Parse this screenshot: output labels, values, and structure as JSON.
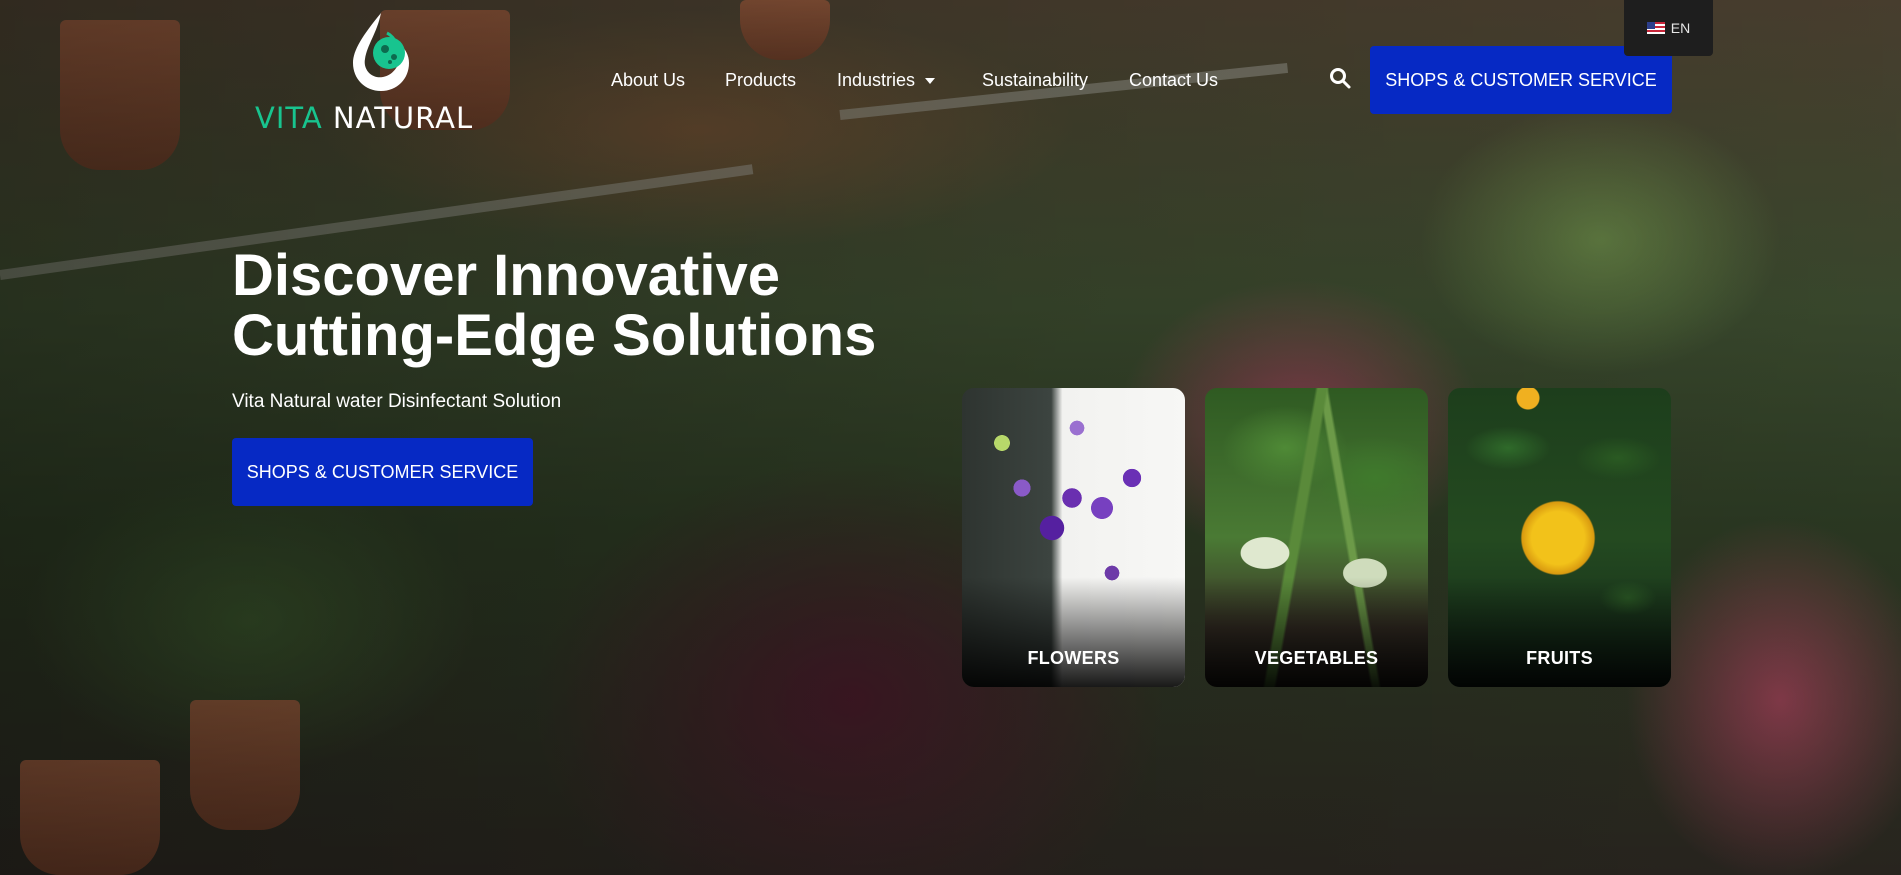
{
  "brand": {
    "name_part1": "VITA",
    "name_part2": "NATURAL",
    "accent_color": "#18c48f"
  },
  "nav": {
    "items": [
      {
        "label": "About Us"
      },
      {
        "label": "Products"
      },
      {
        "label": "Industries",
        "has_dropdown": true
      },
      {
        "label": "Sustainability"
      },
      {
        "label": "Contact Us"
      }
    ],
    "search_icon": "search-icon",
    "cta_label": "SHOPS & CUSTOMER SERVICE",
    "cta_color": "#0629c4"
  },
  "language": {
    "flag_icon": "us-flag-icon",
    "code": "EN"
  },
  "hero": {
    "headline_line1": "Discover Innovative",
    "headline_line2": "Cutting-Edge Solutions",
    "subline": "Vita Natural water Disinfectant Solution",
    "cta_label": "SHOPS & CUSTOMER SERVICE"
  },
  "categories": [
    {
      "label": "FLOWERS"
    },
    {
      "label": "VEGETABLES"
    },
    {
      "label": "FRUITS"
    }
  ]
}
